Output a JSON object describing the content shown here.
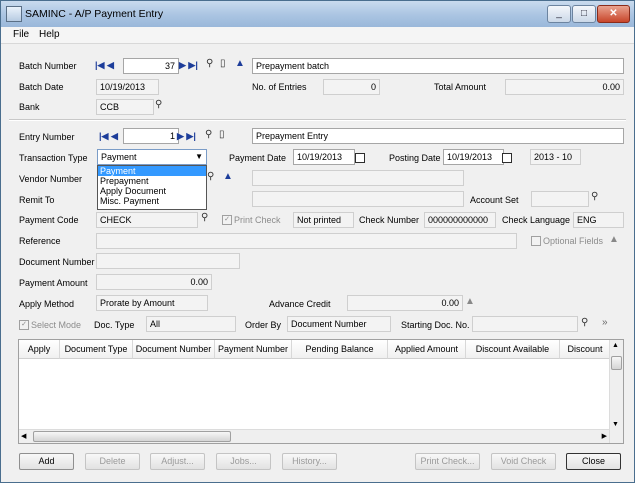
{
  "window": {
    "title": "SAMINC - A/P Payment Entry",
    "controls": {
      "minimize": "_",
      "maximize": "□",
      "close": "✕"
    }
  },
  "menu": [
    "File",
    "Help"
  ],
  "batch": {
    "number_label": "Batch Number",
    "number": "37",
    "description": "Prepayment batch",
    "date_label": "Batch Date",
    "date": "10/19/2013",
    "entries_label": "No. of Entries",
    "entries": "0",
    "total_label": "Total Amount",
    "total": "0.00",
    "bank_label": "Bank",
    "bank": "CCB"
  },
  "entry": {
    "number_label": "Entry Number",
    "number": "1",
    "description": "Prepayment Entry",
    "transaction_type_label": "Transaction Type",
    "transaction_type": "Payment",
    "transaction_type_options": [
      "Payment",
      "Prepayment",
      "Apply Document",
      "Misc. Payment"
    ],
    "payment_date_label": "Payment Date",
    "payment_date": "10/19/2013",
    "posting_date_label": "Posting Date",
    "posting_date": "10/19/2013",
    "year_period": "2013 - 10",
    "vendor_number_label": "Vendor Number",
    "vendor_number": "",
    "remit_to_label": "Remit To",
    "account_set_label": "Account Set",
    "payment_code_label": "Payment Code",
    "payment_code": "CHECK",
    "print_check_label": "Print Check",
    "print_status": "Not printed",
    "check_number_label": "Check Number",
    "check_number": "000000000000",
    "check_language_label": "Check Language",
    "check_language": "ENG",
    "reference_label": "Reference",
    "optional_fields_label": "Optional Fields",
    "document_number_label": "Document Number",
    "payment_amount_label": "Payment Amount",
    "payment_amount": "0.00",
    "apply_method_label": "Apply Method",
    "apply_method": "Prorate by Amount",
    "advance_credit_label": "Advance Credit",
    "advance_credit": "0.00",
    "select_mode_label": "Select Mode",
    "doc_type_label": "Doc. Type",
    "doc_type": "All",
    "order_by_label": "Order By",
    "order_by": "Document Number",
    "starting_doc_label": "Starting Doc. No."
  },
  "grid": {
    "columns": [
      "Apply",
      "Document Type",
      "Document Number",
      "Payment Number",
      "Pending Balance",
      "Applied Amount",
      "Discount Available",
      "Discount"
    ]
  },
  "buttons": {
    "add": "Add",
    "delete": "Delete",
    "adjust": "Adjust...",
    "jobs": "Jobs...",
    "history": "History...",
    "print_check": "Print Check...",
    "void_check": "Void Check",
    "close": "Close"
  },
  "icons": {
    "first": "first-icon",
    "previous": "previous-icon",
    "next": "next-icon",
    "last": "last-icon",
    "finder": "magnifier-icon",
    "new": "new-document-icon",
    "zoom": "zoom-up-icon",
    "calendar": "calendar-icon"
  }
}
